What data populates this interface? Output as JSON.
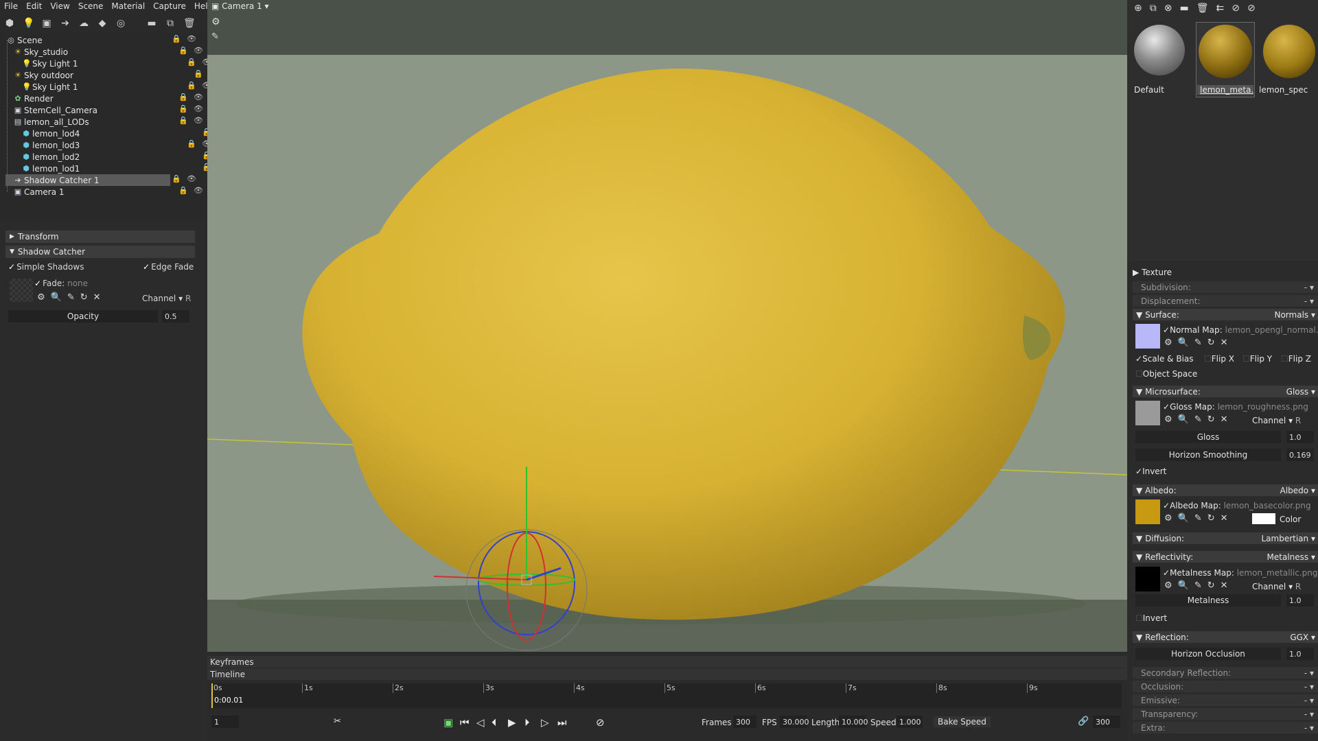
{
  "menu": [
    "File",
    "Edit",
    "View",
    "Scene",
    "Material",
    "Capture",
    "Help"
  ],
  "viewport": {
    "camera_label": "Camera 1 ▾"
  },
  "outline": {
    "items": [
      {
        "label": "Scene",
        "icon": "scene-icon"
      },
      {
        "label": "Sky_studio",
        "icon": "sky-icon"
      },
      {
        "label": "Sky Light 1",
        "icon": "light-icon"
      },
      {
        "label": "Sky outdoor",
        "icon": "sky-icon"
      },
      {
        "label": "Sky Light 1",
        "icon": "light-icon"
      },
      {
        "label": "Render",
        "icon": "render-icon"
      },
      {
        "label": "StemCell_Camera",
        "icon": "camera-icon"
      },
      {
        "label": "lemon_all_LODs",
        "icon": "group-icon"
      },
      {
        "label": "lemon_lod4",
        "icon": "mesh-icon"
      },
      {
        "label": "lemon_lod3",
        "icon": "mesh-icon"
      },
      {
        "label": "lemon_lod2",
        "icon": "mesh-icon"
      },
      {
        "label": "lemon_lod1",
        "icon": "mesh-icon"
      },
      {
        "label": "Shadow Catcher 1",
        "icon": "shadow-catcher-icon"
      },
      {
        "label": "Camera 1",
        "icon": "camera-icon"
      }
    ]
  },
  "props": {
    "transform": "Transform",
    "shadow_catcher": "Shadow Catcher",
    "simple_shadows": "Simple Shadows",
    "edge_fade": "Edge Fade",
    "fade_label": "Fade:",
    "fade_value": "none",
    "channel_label": "Channel",
    "channel_value": "R",
    "opacity_label": "Opacity",
    "opacity_value": "0.5"
  },
  "materials": [
    {
      "name": "Default",
      "color": "#9a9a9a"
    },
    {
      "name": "lemon_meta...",
      "color": "#9a7a18"
    },
    {
      "name": "lemon_spec",
      "color": "#a98216"
    }
  ],
  "mat": {
    "texture": "Texture",
    "subdivision": "Subdivision:",
    "displacement": "Displacement:",
    "dash": "-",
    "surface": "Surface:",
    "surface_mode": "Normals",
    "normal_map": "Normal Map:",
    "normal_file": "lemon_opengl_normal.png",
    "scale_bias": "Scale & Bias",
    "flip_x": "Flip X",
    "flip_y": "Flip Y",
    "flip_z": "Flip Z",
    "object_space": "Object Space",
    "microsurface": "Microsurface:",
    "micro_mode": "Gloss",
    "gloss_map": "Gloss Map:",
    "gloss_file": "lemon_roughness.png",
    "channel": "Channel",
    "channel_r": "R",
    "gloss": "Gloss",
    "gloss_val": "1.0",
    "horizon_smoothing": "Horizon Smoothing",
    "horizon_val": "0.169",
    "invert": "Invert",
    "albedo": "Albedo:",
    "albedo_mode": "Albedo",
    "albedo_map": "Albedo Map:",
    "albedo_file": "lemon_basecolor.png",
    "color": "Color",
    "diffusion": "Diffusion:",
    "diffusion_mode": "Lambertian",
    "reflectivity": "Reflectivity:",
    "reflectivity_mode": "Metalness",
    "metalness_map": "Metalness Map:",
    "metalness_file": "lemon_metallic.png",
    "metalness": "Metalness",
    "metalness_val": "1.0",
    "invert2": "Invert",
    "reflection": "Reflection:",
    "reflection_mode": "GGX",
    "horizon_occlusion": "Horizon Occlusion",
    "horizon_occ_val": "1.0",
    "secondary": "Secondary Reflection:",
    "occlusion": "Occlusion:",
    "emissive": "Emissive:",
    "transparency": "Transparency:",
    "extra": "Extra:"
  },
  "timeline": {
    "keyframes": "Keyframes",
    "timeline": "Timeline",
    "ticks": [
      "0s",
      "1s",
      "2s",
      "3s",
      "4s",
      "5s",
      "6s",
      "7s",
      "8s",
      "9s"
    ],
    "current_time": "0:00.01",
    "frame": "1",
    "frames_label": "Frames",
    "frames_val": "300",
    "fps_label": "FPS",
    "fps_val": "30.000",
    "length_label": "Length",
    "length_val": "10.000",
    "speed_label": "Speed",
    "speed_val": "1.000",
    "bake_speed": "Bake Speed",
    "end_frame": "300"
  },
  "colors": {
    "lemon": "#d8b534",
    "viewport_bg": "#8c9787",
    "panel": "#2b2b2b"
  }
}
